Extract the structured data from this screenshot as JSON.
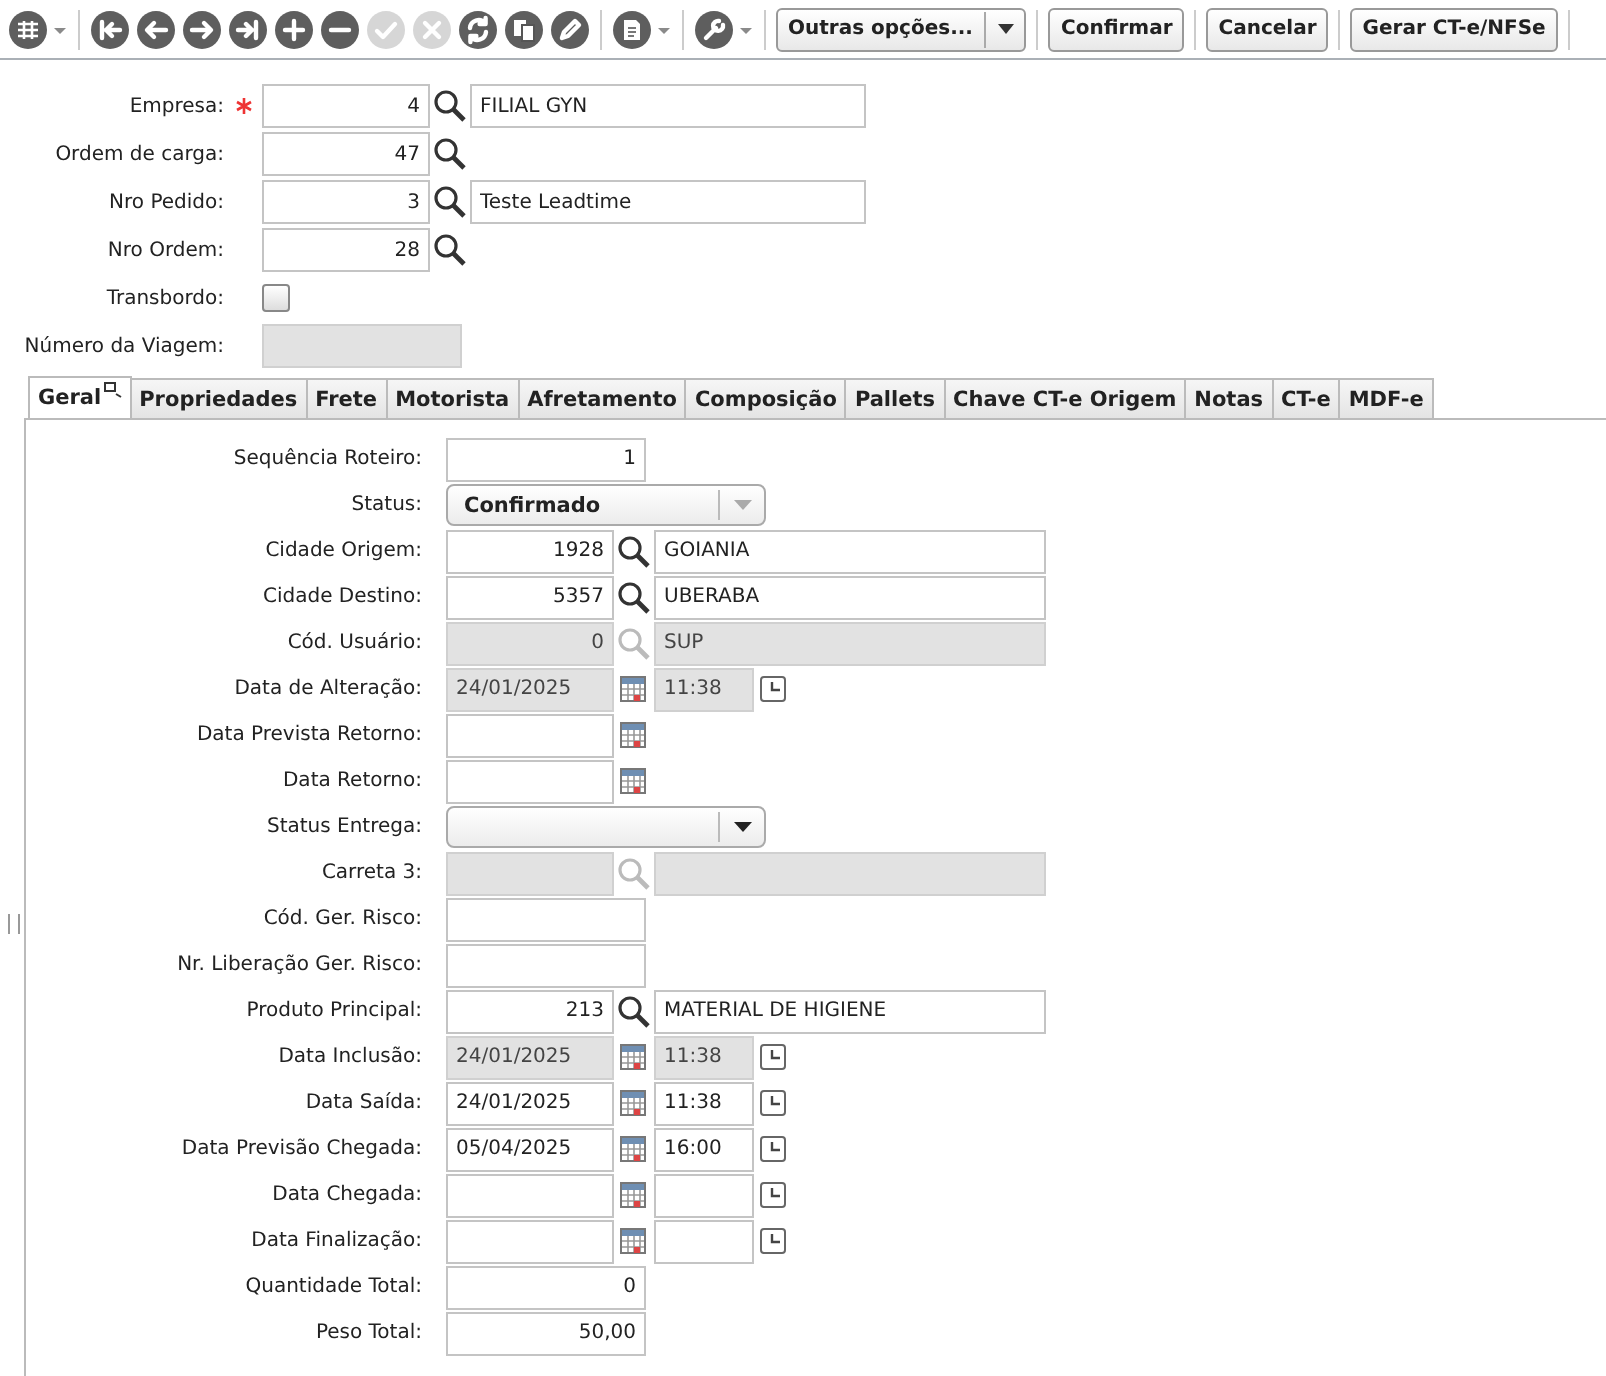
{
  "toolbar": {
    "groups": [
      [
        {
          "kind": "grid-menu",
          "disabled": false
        }
      ],
      [
        {
          "kind": "first",
          "disabled": false
        },
        {
          "kind": "previous",
          "disabled": false
        },
        {
          "kind": "next",
          "disabled": false
        },
        {
          "kind": "last",
          "disabled": false
        },
        {
          "kind": "add",
          "disabled": false
        },
        {
          "kind": "remove",
          "disabled": false
        },
        {
          "kind": "confirm",
          "disabled": true
        },
        {
          "kind": "cancel",
          "disabled": true
        },
        {
          "kind": "refresh",
          "disabled": false
        },
        {
          "kind": "copy",
          "disabled": false
        },
        {
          "kind": "edit",
          "disabled": false
        }
      ],
      [
        {
          "kind": "document-menu",
          "disabled": false
        }
      ],
      [
        {
          "kind": "tools-menu",
          "disabled": false
        }
      ]
    ],
    "buttons": [
      {
        "label": "Outras opções...",
        "kind": "dropdown"
      },
      {
        "label": "Confirmar",
        "kind": "plain"
      },
      {
        "label": "Cancelar",
        "kind": "plain"
      },
      {
        "label": "Gerar CT-e/NFSe",
        "kind": "plain"
      }
    ]
  },
  "header": [
    {
      "label": "Empresa:",
      "kind": "code-lookup",
      "required": true,
      "code": "4",
      "description": "FILIAL GYN"
    },
    {
      "label": "Ordem de carga:",
      "kind": "code-search",
      "required": false,
      "code": "47"
    },
    {
      "label": "Nro Pedido:",
      "kind": "code-lookup",
      "required": false,
      "code": "3",
      "description": "Teste Leadtime"
    },
    {
      "label": "Nro Ordem:",
      "kind": "code-search",
      "required": false,
      "code": "28"
    },
    {
      "label": "Transbordo:",
      "kind": "checkbox",
      "required": false,
      "checked": false
    },
    {
      "label": "Número da Viagem:",
      "kind": "text",
      "required": false,
      "disabled": true
    }
  ],
  "tabs": [
    {
      "label": "Geral",
      "selected": true
    },
    {
      "label": "Propriedades",
      "selected": false
    },
    {
      "label": "Frete",
      "selected": false
    },
    {
      "label": "Motorista",
      "selected": false
    },
    {
      "label": "Afretamento",
      "selected": false
    },
    {
      "label": "Composição",
      "selected": false
    },
    {
      "label": "Pallets",
      "selected": false
    },
    {
      "label": "Chave CT-e Origem",
      "selected": false
    },
    {
      "label": "Notas",
      "selected": false
    },
    {
      "label": "CT-e",
      "selected": false
    },
    {
      "label": "MDF-e",
      "selected": false
    }
  ],
  "form": [
    {
      "label": "Sequência Roteiro:",
      "kind": "number",
      "value": "1",
      "disabled": false
    },
    {
      "label": "Status:",
      "kind": "select",
      "value": "Confirmado",
      "disabled": true
    },
    {
      "label": "Cidade Origem:",
      "kind": "code-lookup",
      "code": "1928",
      "description": "GOIANIA",
      "disabled": false
    },
    {
      "label": "Cidade Destino:",
      "kind": "code-lookup",
      "code": "5357",
      "description": "UBERABA",
      "disabled": false
    },
    {
      "label": "Cód. Usuário:",
      "kind": "code-lookup",
      "code": "0",
      "description": "SUP",
      "disabled": true
    },
    {
      "label": "Data de Alteração:",
      "kind": "date-time",
      "date": "24/01/2025",
      "time": "11:38",
      "disabled": true
    },
    {
      "label": "Data Prevista Retorno:",
      "kind": "date",
      "disabled": false
    },
    {
      "label": "Data Retorno:",
      "kind": "date",
      "disabled": false
    },
    {
      "label": "Status Entrega:",
      "kind": "select",
      "disabled": false
    },
    {
      "label": "Carreta 3:",
      "kind": "code-lookup",
      "disabled": true
    },
    {
      "label": "Cód. Ger. Risco:",
      "kind": "number",
      "disabled": false
    },
    {
      "label": "Nr. Liberação Ger. Risco:",
      "kind": "number",
      "disabled": false
    },
    {
      "label": "Produto Principal:",
      "kind": "code-lookup",
      "code": "213",
      "description": "MATERIAL DE HIGIENE",
      "disabled": false
    },
    {
      "label": "Data Inclusão:",
      "kind": "date-time",
      "date": "24/01/2025",
      "time": "11:38",
      "disabled": true
    },
    {
      "label": "Data Saída:",
      "kind": "date-time",
      "date": "24/01/2025",
      "time": "11:38",
      "disabled": false
    },
    {
      "label": "Data Previsão Chegada:",
      "kind": "date-time",
      "date": "05/04/2025",
      "time": "16:00",
      "disabled": false
    },
    {
      "label": "Data Chegada:",
      "kind": "date-time",
      "disabled": false
    },
    {
      "label": "Data Finalização:",
      "kind": "date-time",
      "disabled": false
    },
    {
      "label": "Quantidade Total:",
      "kind": "number",
      "value": "0",
      "disabled": false
    },
    {
      "label": "Peso Total:",
      "kind": "number",
      "value": "50,00",
      "disabled": false
    }
  ]
}
